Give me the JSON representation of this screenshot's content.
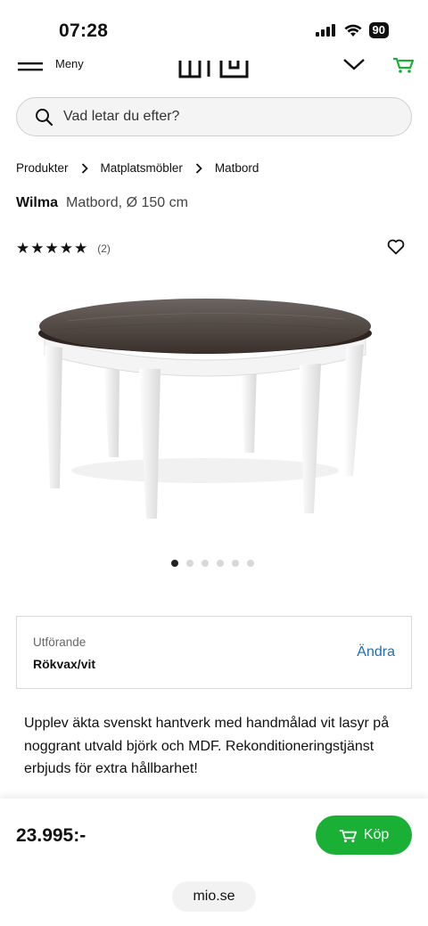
{
  "status": {
    "time": "07:28",
    "battery": "90"
  },
  "header": {
    "menu_label": "Meny",
    "logo_icon": "mio-logo",
    "accent": "#1ab036"
  },
  "search": {
    "placeholder": "Vad letar du efter?"
  },
  "breadcrumb": [
    "Produkter",
    "Matplatsmöbler",
    "Matbord"
  ],
  "product": {
    "name": "Wilma",
    "subtitle": "Matbord, Ø 150 cm",
    "rating": 5,
    "rating_stars": "★★★★★",
    "review_count": "(2)",
    "image_count": 6,
    "active_image": 1
  },
  "variant": {
    "label": "Utförande",
    "value": "Rökvax/vit",
    "change": "Ändra",
    "link_color": "#1c6fb5"
  },
  "description": "Upplev äkta svenskt hantverk med handmålad vit lasyr på noggrant utvald björk och MDF. Rekonditioneringstjänst erbjuds för extra hållbarhet!",
  "purchase": {
    "price": "23.995:-",
    "buy_label": "Köp",
    "button_color": "#1ab036"
  },
  "browser": {
    "url": "mio.se"
  }
}
